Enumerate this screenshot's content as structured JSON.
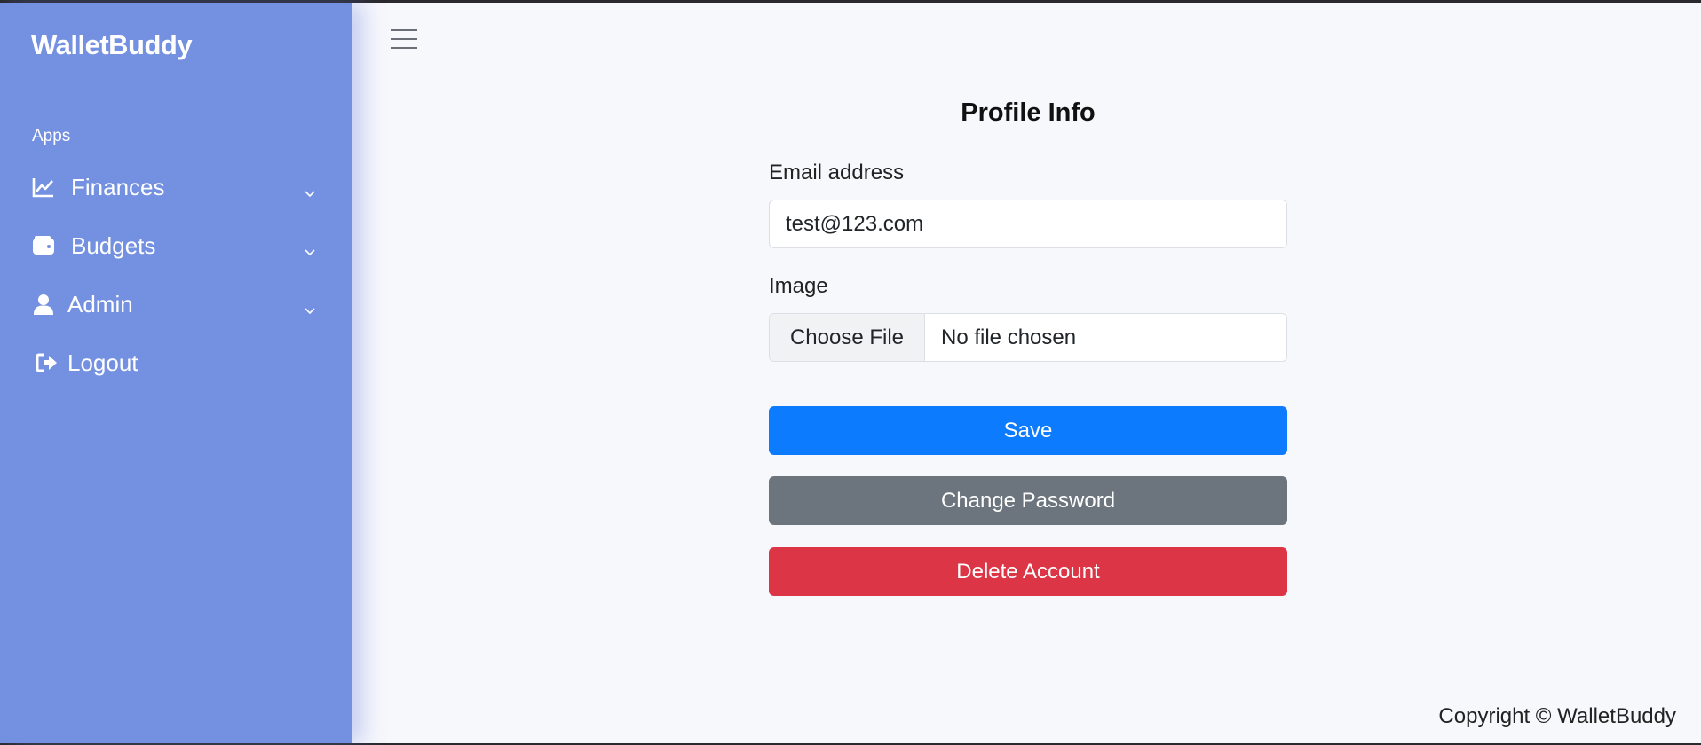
{
  "sidebar": {
    "brand": "WalletBuddy",
    "section_label": "Apps",
    "items": [
      {
        "label": "Finances",
        "icon": "chart-line-icon",
        "has_submenu": true
      },
      {
        "label": "Budgets",
        "icon": "wallet-icon",
        "has_submenu": true
      },
      {
        "label": "Admin",
        "icon": "user-icon",
        "has_submenu": true
      },
      {
        "label": "Logout",
        "icon": "logout-icon",
        "has_submenu": false
      }
    ]
  },
  "topbar": {
    "menu_icon": "hamburger-icon"
  },
  "profile": {
    "title": "Profile Info",
    "email_label": "Email address",
    "email_value": "test@123.com",
    "image_label": "Image",
    "file_button_label": "Choose File",
    "file_status": "No file chosen",
    "save_label": "Save",
    "change_password_label": "Change Password",
    "delete_label": "Delete Account"
  },
  "footer": {
    "copyright": "Copyright © WalletBuddy"
  },
  "colors": {
    "sidebar": "#7490e0",
    "primary": "#0d7bfd",
    "secondary": "#6c757d",
    "danger": "#dc3545",
    "background": "#f7f8fc"
  }
}
